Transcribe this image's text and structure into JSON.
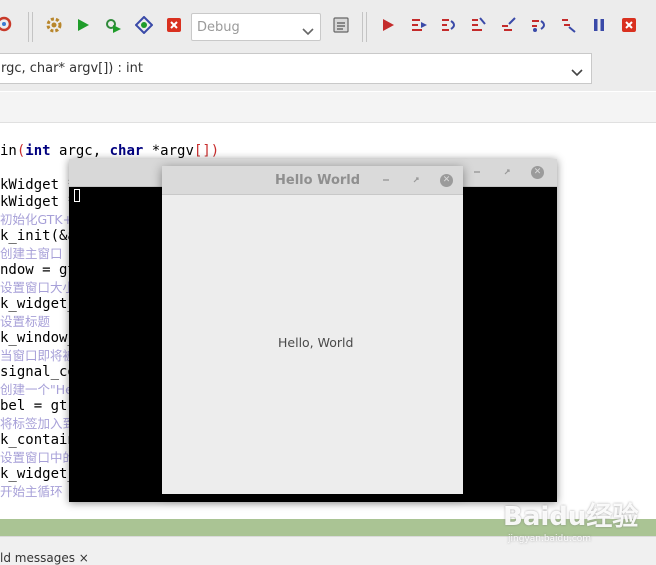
{
  "toolbar": {
    "build_config": "Debug",
    "icons": [
      "compile-icon",
      "settings-icon",
      "run-icon",
      "build-run-icon",
      "rebuild-icon",
      "abort-icon",
      "debug-start-icon",
      "run-to-cursor-icon",
      "next-line-icon",
      "step-into-icon",
      "step-out-icon",
      "next-instruction-icon",
      "step-into-instruction-icon",
      "break-debugger-icon",
      "stop-debugger-icon"
    ],
    "colors": {
      "run": "#1f9c2a",
      "abort": "#d9301f",
      "debug": "#c42b2b",
      "pause": "#3a4aa8",
      "settings": "#b8862c"
    }
  },
  "function_selector": {
    "value": "rgc, char* argv[]) : int"
  },
  "code": {
    "line1_fn": "in",
    "line1_kw_int": "int",
    "line1_argc": " argc, ",
    "line1_kw_char": "char",
    "line1_argv": " *argv",
    "line1_brackets": "[])",
    "lines": [
      "kWidget *w",
      "kWidget *l",
      "初始化GTK+库",
      "k_init(&ar",
      "创建主窗口",
      "ndow = gtk",
      "设置窗口大小",
      "k_widget_s",
      "设置标题",
      "k_window_s",
      "当窗口即将被",
      "signal_con",
      "创建一个\"He",
      "bel = gtk_",
      "将标签加入到",
      "k_containe",
      "设置窗口中的",
      "k_widget_s",
      "开始主循环"
    ]
  },
  "hello_window": {
    "title": "Hello World",
    "label": "Hello, World"
  },
  "bottom": {
    "tab": "ld messages ×"
  },
  "watermark": {
    "brand": "Baidu经验",
    "url": "jingyan.baidu.com"
  }
}
